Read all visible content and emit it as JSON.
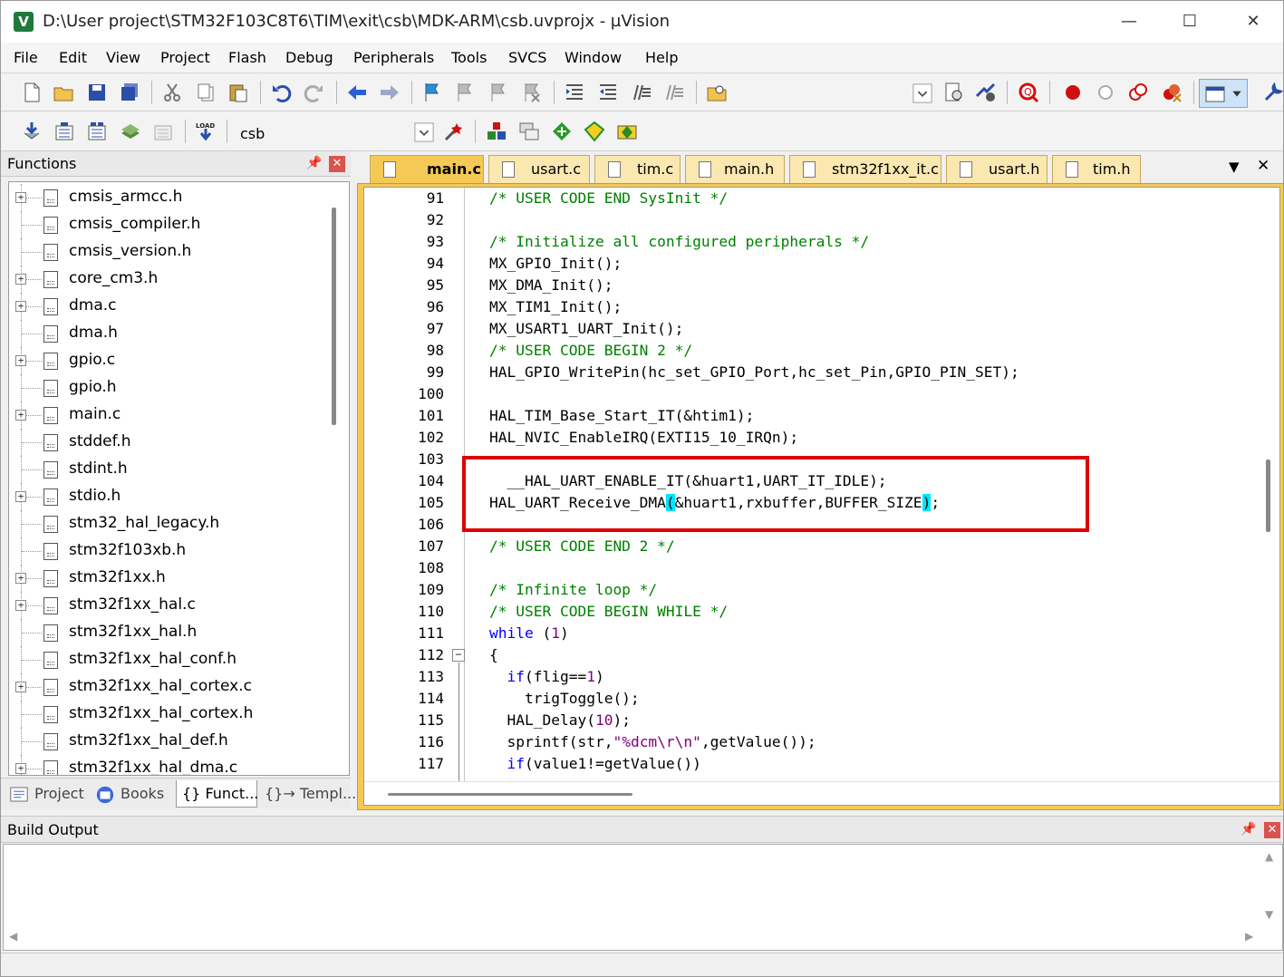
{
  "window": {
    "title": "D:\\User project\\STM32F103C8T6\\TIM\\exit\\csb\\MDK-ARM\\csb.uvprojx - µVision",
    "app_icon": "uvision-icon",
    "app_icon_glyph": "V",
    "minimize_glyph": "—",
    "maximize_glyph": "☐",
    "close_glyph": "✕"
  },
  "menu": [
    "File",
    "Edit",
    "View",
    "Project",
    "Flash",
    "Debug",
    "Peripherals",
    "Tools",
    "SVCS",
    "Window",
    "Help"
  ],
  "build_toolbar": {
    "target": "csb"
  },
  "functions_panel": {
    "title": "Functions",
    "pin_glyph": "📌",
    "close_glyph": "✕",
    "expand_glyph": "+",
    "files": [
      {
        "name": "cmsis_armcc.h",
        "expandable": true
      },
      {
        "name": "cmsis_compiler.h",
        "expandable": false
      },
      {
        "name": "cmsis_version.h",
        "expandable": false
      },
      {
        "name": "core_cm3.h",
        "expandable": true
      },
      {
        "name": "dma.c",
        "expandable": true
      },
      {
        "name": "dma.h",
        "expandable": false
      },
      {
        "name": "gpio.c",
        "expandable": true
      },
      {
        "name": "gpio.h",
        "expandable": false
      },
      {
        "name": "main.c",
        "expandable": true
      },
      {
        "name": "stddef.h",
        "expandable": false
      },
      {
        "name": "stdint.h",
        "expandable": false
      },
      {
        "name": "stdio.h",
        "expandable": true
      },
      {
        "name": "stm32_hal_legacy.h",
        "expandable": false
      },
      {
        "name": "stm32f103xb.h",
        "expandable": false
      },
      {
        "name": "stm32f1xx.h",
        "expandable": true
      },
      {
        "name": "stm32f1xx_hal.c",
        "expandable": true
      },
      {
        "name": "stm32f1xx_hal.h",
        "expandable": false
      },
      {
        "name": "stm32f1xx_hal_conf.h",
        "expandable": false
      },
      {
        "name": "stm32f1xx_hal_cortex.c",
        "expandable": true
      },
      {
        "name": "stm32f1xx_hal_cortex.h",
        "expandable": false
      },
      {
        "name": "stm32f1xx_hal_def.h",
        "expandable": false
      },
      {
        "name": "stm32f1xx_hal_dma.c",
        "expandable": true
      }
    ],
    "tabs": [
      "Project",
      "Books",
      "{} Funct...",
      "{}→ Templ..."
    ]
  },
  "editor": {
    "tabs": [
      {
        "name": "main.c",
        "active": true
      },
      {
        "name": "usart.c",
        "active": false
      },
      {
        "name": "tim.c",
        "active": false
      },
      {
        "name": "main.h",
        "active": false
      },
      {
        "name": "stm32f1xx_it.c",
        "active": false
      },
      {
        "name": "usart.h",
        "active": false
      },
      {
        "name": "tim.h",
        "active": false
      }
    ],
    "tab_menu_glyph": "▼",
    "close_glyph": "✕",
    "collapse_glyph": "−",
    "lines": [
      {
        "n": "91",
        "t": "/* USER CODE END SysInit */"
      },
      {
        "n": "92",
        "t": ""
      },
      {
        "n": "93",
        "t": "/* Initialize all configured peripherals */"
      },
      {
        "n": "94",
        "t": "MX_GPIO_Init();"
      },
      {
        "n": "95",
        "t": "MX_DMA_Init();"
      },
      {
        "n": "96",
        "t": "MX_TIM1_Init();"
      },
      {
        "n": "97",
        "t": "MX_USART1_UART_Init();"
      },
      {
        "n": "98",
        "t": "/* USER CODE BEGIN 2 */"
      },
      {
        "n": "99",
        "t": "HAL_GPIO_WritePin(hc_set_GPIO_Port,hc_set_Pin,GPIO_PIN_SET);"
      },
      {
        "n": "100",
        "t": ""
      },
      {
        "n": "101",
        "t": "HAL_TIM_Base_Start_IT(&htim1);"
      },
      {
        "n": "102",
        "t": "HAL_NVIC_EnableIRQ(EXTI15_10_IRQn);"
      },
      {
        "n": "103",
        "t": ""
      },
      {
        "n": "104",
        "t": "  __HAL_UART_ENABLE_IT(&huart1,UART_IT_IDLE);"
      },
      {
        "n": "105",
        "t": "HAL_UART_Receive_DMA(&huart1,rxbuffer,BUFFER_SIZE);"
      },
      {
        "n": "106",
        "t": ""
      },
      {
        "n": "107",
        "t": "/* USER CODE END 2 */"
      },
      {
        "n": "108",
        "t": ""
      },
      {
        "n": "109",
        "t": "/* Infinite loop */"
      },
      {
        "n": "110",
        "t": "/* USER CODE BEGIN WHILE */"
      },
      {
        "n": "111",
        "t": "while (1)"
      },
      {
        "n": "112",
        "t": "{"
      },
      {
        "n": "113",
        "t": "  if(flig==1)"
      },
      {
        "n": "114",
        "t": "    trigToggle();"
      },
      {
        "n": "115",
        "t": "  HAL_Delay(10);"
      },
      {
        "n": "116",
        "t": "  sprintf(str,\"%dcm\\r\\n\",getValue());"
      },
      {
        "n": "117",
        "t": "  if(value1!=getValue())"
      }
    ],
    "snippets": {
      "l111_kw": "while",
      "l111_rest": " (",
      "l111_num": "1",
      "l111_end": ")",
      "l113_kw": "if",
      "l113_a": "(flig==",
      "l113_num": "1",
      "l113_end": ")",
      "l115_a": "HAL_Delay(",
      "l115_num": "10",
      "l115_end": ");",
      "l116_a": "sprintf(str,",
      "l116_str": "\"%dcm\\r\\n\"",
      "l116_end": ",getValue());",
      "l117_kw": "if",
      "l117_rest": "(value1!=getValue())",
      "l105_a": "HAL_UART_Receive_DMA",
      "l105_paren_open": "(",
      "l105_mid": "&huart1,rxbuffer,BUFFER_SIZE",
      "l105_paren_close": ")",
      "l105_end": ";"
    }
  },
  "build_output": {
    "title": "Build Output",
    "pin_glyph": "📌",
    "close_glyph": "✕",
    "scroll_up_glyph": "▲",
    "scroll_down_glyph": "▼",
    "scroll_left_glyph": "◀",
    "scroll_right_glyph": "▶"
  },
  "colors": {
    "editor_frame": "#f5c955",
    "comment": "#008000",
    "keyword": "#0000ff",
    "number": "#800080",
    "bracket_highlight": "#00e5ff",
    "annotation_box": "#e00000"
  }
}
